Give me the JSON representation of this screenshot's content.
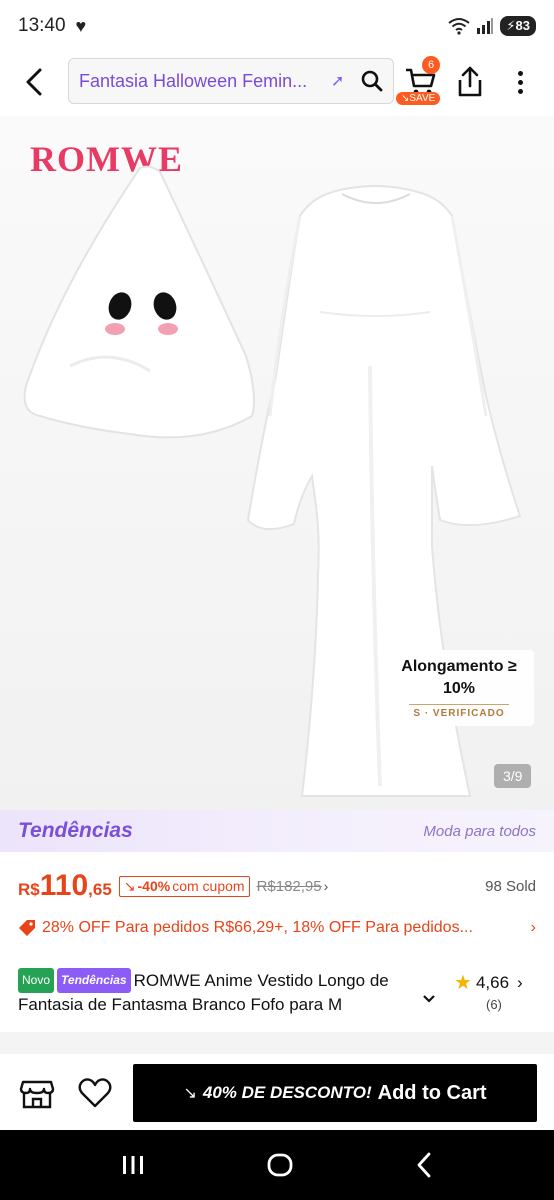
{
  "status_bar": {
    "time": "13:40",
    "battery": "83"
  },
  "header": {
    "search_query": "Fantasia Halloween Femin...",
    "cart_count": "6",
    "cart_save_label": "SAVE"
  },
  "gallery": {
    "brand_logo": "ROMWE",
    "badge_line1": "Alongamento ≥ 10%",
    "badge_line2": "S · VERIFICADO",
    "counter": "3/9"
  },
  "trends_strip": {
    "logo": "Tendências",
    "tagline": "Moda para todos"
  },
  "price": {
    "currency": "R$",
    "integer": "110",
    "decimal": ",65",
    "coupon_discount": "-40%",
    "coupon_label": "com cupom",
    "original": "R$182,95",
    "sold": "98 Sold"
  },
  "promo": {
    "text": "28% OFF Para pedidos R$66,29+,  18% OFF Para pedidos..."
  },
  "product": {
    "pill_novo": "Novo",
    "pill_trend": "Tendências",
    "title": "ROMWE Anime Vestido Longo de Fantasia de Fantasma Branco Fofo para M",
    "rating": "4,66",
    "review_count": "(6)"
  },
  "bottom_bar": {
    "discount_label": "40% DE DESCONTO!",
    "add_to_cart": "Add to Cart"
  },
  "colors": {
    "accent_orange": "#e8441a",
    "trend_purple": "#8b5cf6",
    "brand_pink": "#e73a64"
  }
}
